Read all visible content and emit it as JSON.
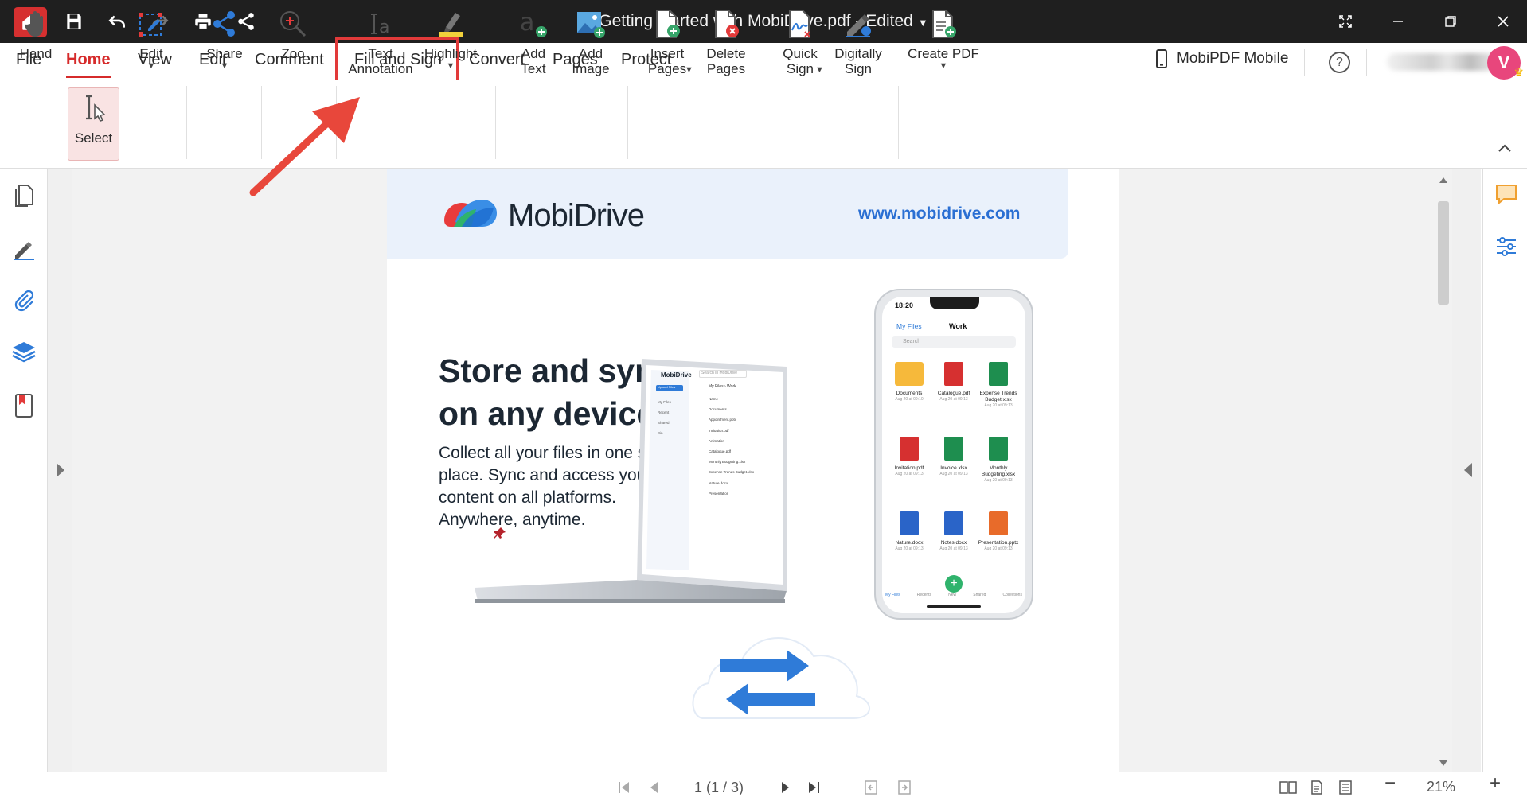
{
  "titlebar": {
    "title": "Getting started with MobiDrive.pdf - Edited",
    "home_icon": "home-icon",
    "save_icon": "save-icon",
    "undo_icon": "undo-icon",
    "redo_icon": "redo-icon",
    "print_icon": "print-icon",
    "share_icon": "share-icon"
  },
  "menu": {
    "items": [
      "File",
      "Home",
      "View",
      "Edit",
      "Comment",
      "Fill and Sign",
      "Convert",
      "Pages",
      "Protect"
    ],
    "active": "Home",
    "mobile_link": "MobiPDF Mobile",
    "help": "?",
    "avatar_initial": "V"
  },
  "ribbon": {
    "tools": [
      {
        "label": "Hand"
      },
      {
        "label": "Select"
      },
      {
        "label": "Edit"
      },
      {
        "label": "Share"
      },
      {
        "label": "Zoo"
      },
      {
        "label": "Text",
        "label2": "Annotation"
      },
      {
        "label": "Highlight"
      },
      {
        "label": "Add",
        "label2": "Text"
      },
      {
        "label": "Add",
        "label2": "Image"
      },
      {
        "label": "Insert",
        "label2": "Pages"
      },
      {
        "label": "Delete",
        "label2": "Pages"
      },
      {
        "label": "Quick",
        "label2": "Sign"
      },
      {
        "label": "Digitally",
        "label2": "Sign"
      },
      {
        "label": "Create PDF"
      }
    ]
  },
  "document": {
    "brand_name": "MobiDrive",
    "brand_url": "www.mobidrive.com",
    "headline_1": "Store and sync",
    "headline_2": "on any device",
    "body": "Collect all your files in one safe place. Sync and access your content on all platforms. Anywhere, anytime.",
    "phone": {
      "time": "18:20",
      "back": "My Files",
      "folder": "Work",
      "search": "Search",
      "files": [
        {
          "name": "Documents",
          "meta": "Aug 20 at 09:10",
          "type": "folder"
        },
        {
          "name": "Catalogue.pdf",
          "meta": "Aug 20 at 09:13",
          "type": "pdf"
        },
        {
          "name": "Expense Trends Budget.xlsx",
          "meta": "Aug 20 at 09:13",
          "type": "xlsx"
        },
        {
          "name": "Invitation.pdf",
          "meta": "Aug 20 at 09:13",
          "type": "pdf"
        },
        {
          "name": "Invoice.xlsx",
          "meta": "Aug 20 at 09:13",
          "type": "xlsx"
        },
        {
          "name": "Monthly Budgeting.xlsx",
          "meta": "Aug 20 at 09:13",
          "type": "xlsx"
        },
        {
          "name": "Nature.docx",
          "meta": "Aug 20 at 09:13",
          "type": "docx"
        },
        {
          "name": "Notes.docx",
          "meta": "Aug 20 at 09:13",
          "type": "docx"
        },
        {
          "name": "Presentation.pptx",
          "meta": "Aug 20 at 09:13",
          "type": "pptx"
        }
      ],
      "tabs": [
        "My Files",
        "Recents",
        "New",
        "Shared",
        "Collections"
      ]
    },
    "laptop": {
      "brand": "MobiDrive",
      "search": "Search in MobiDrive",
      "crumb": "My Files  ›  Work",
      "upload": "Upload Files",
      "nav": [
        "My Files",
        "Recent",
        "Shared",
        "Bin"
      ],
      "files": [
        "Name",
        "Documents",
        "Appointment.pptx",
        "Invitation.pdf",
        "Animation",
        "Catalogue.pdf",
        "Monthly Budgeting.xlsx",
        "Expense Trends Budget.xlsx",
        "Nature.docx",
        "Presentation"
      ]
    }
  },
  "status": {
    "page_indicator": "1 (1 / 3)",
    "zoom": "21%",
    "minus": "−",
    "plus": "+"
  },
  "colors": {
    "accent": "#d62b2b",
    "titlebar": "#1f1f1f",
    "highlight_box": "#e23a3a",
    "brand_blue": "#2a6fd3"
  }
}
